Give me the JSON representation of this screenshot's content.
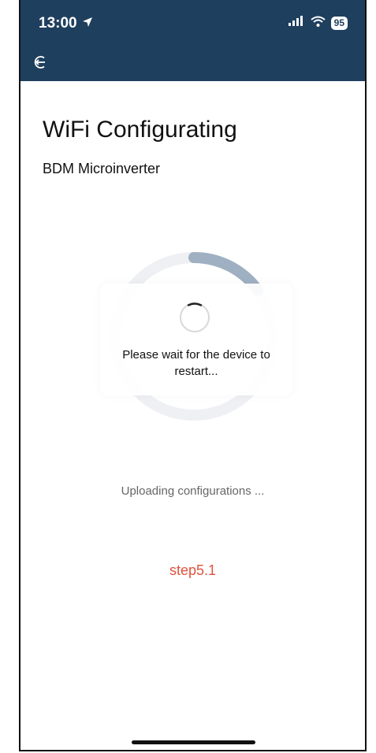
{
  "status_bar": {
    "time": "13:00",
    "battery": "95"
  },
  "header": {
    "back_icon": "back-circle-arrow-icon"
  },
  "main": {
    "title": "WiFi Configurating",
    "device": "BDM Microinverter",
    "progress": 0.15,
    "loading_message": "Please wait for the device to restart...",
    "status": "Uploading configurations ...",
    "step": "step5.1"
  },
  "colors": {
    "header_bg": "#1f3f5e",
    "accent": "#e0533d",
    "ring_track": "#eef0f3",
    "ring_fill": "#9fb0c2"
  }
}
